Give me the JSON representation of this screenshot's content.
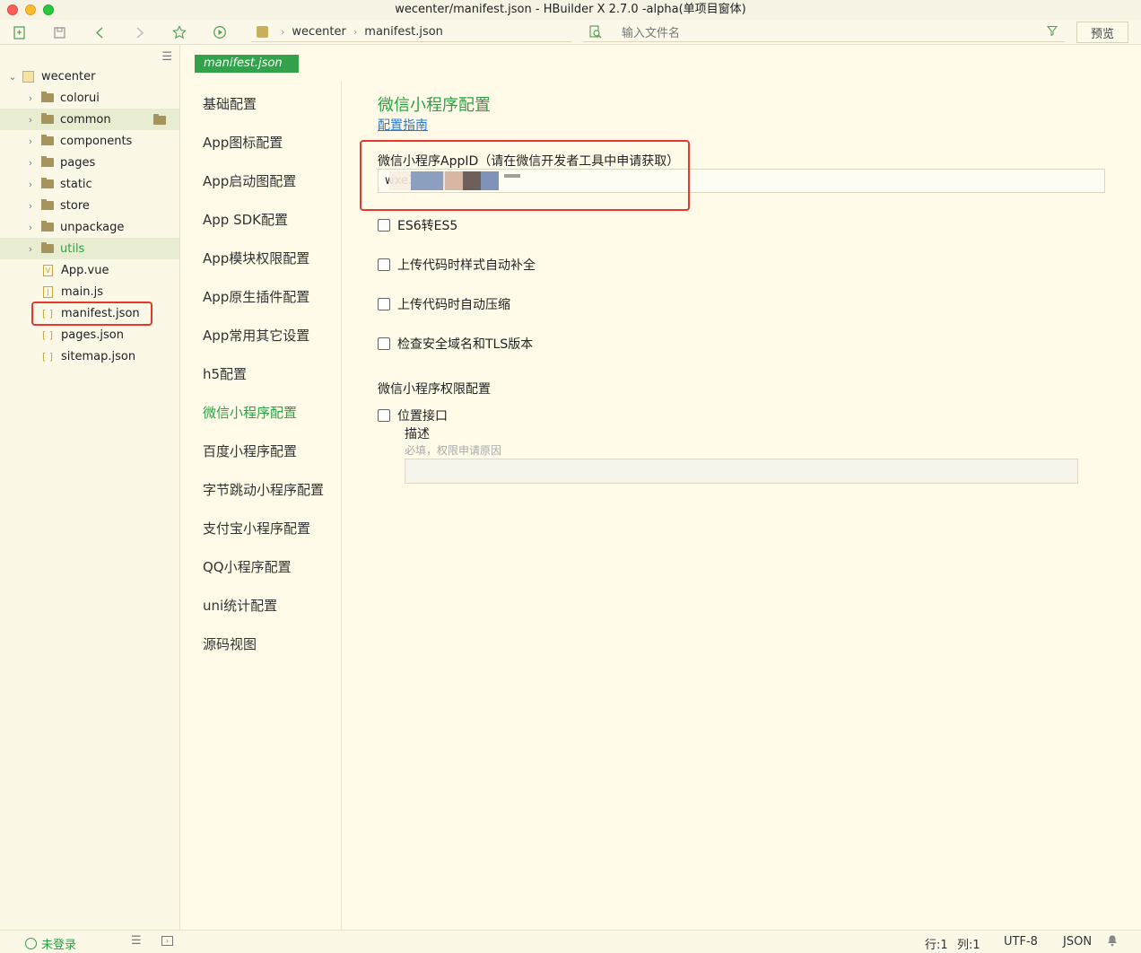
{
  "window": {
    "title": "wecenter/manifest.json - HBuilder X 2.7.0 -alpha(单项目窗体)"
  },
  "toolbar": {
    "breadcrumb": {
      "project": "wecenter",
      "file": "manifest.json"
    },
    "search_placeholder": "输入文件名",
    "preview_label": "预览"
  },
  "sidebar": {
    "project": "wecenter",
    "folders": [
      "colorui",
      "common",
      "components",
      "pages",
      "static",
      "store",
      "unpackage",
      "utils"
    ],
    "files": [
      "App.vue",
      "main.js",
      "manifest.json",
      "pages.json",
      "sitemap.json"
    ]
  },
  "editor": {
    "tab": "manifest.json"
  },
  "menu": {
    "items": [
      "基础配置",
      "App图标配置",
      "App启动图配置",
      "App SDK配置",
      "App模块权限配置",
      "App原生插件配置",
      "App常用其它设置",
      "h5配置",
      "微信小程序配置",
      "百度小程序配置",
      "字节跳动小程序配置",
      "支付宝小程序配置",
      "QQ小程序配置",
      "uni统计配置",
      "源码视图"
    ],
    "active": "微信小程序配置"
  },
  "content": {
    "title": "微信小程序配置",
    "guide_link": "配置指南",
    "appid_label": "微信小程序AppID（请在微信开发者工具中申请获取）",
    "appid_value": "wxe349",
    "checkboxes": [
      "ES6转ES5",
      "上传代码时样式自动补全",
      "上传代码时自动压缩",
      "检查安全域名和TLS版本"
    ],
    "permission_title": "微信小程序权限配置",
    "location_label": "位置接口",
    "desc_label": "描述",
    "desc_placeholder": "必填，权限申请原因"
  },
  "statusbar": {
    "login": "未登录",
    "line": "行:1",
    "col": "列:1",
    "encoding": "UTF-8",
    "language": "JSON"
  }
}
